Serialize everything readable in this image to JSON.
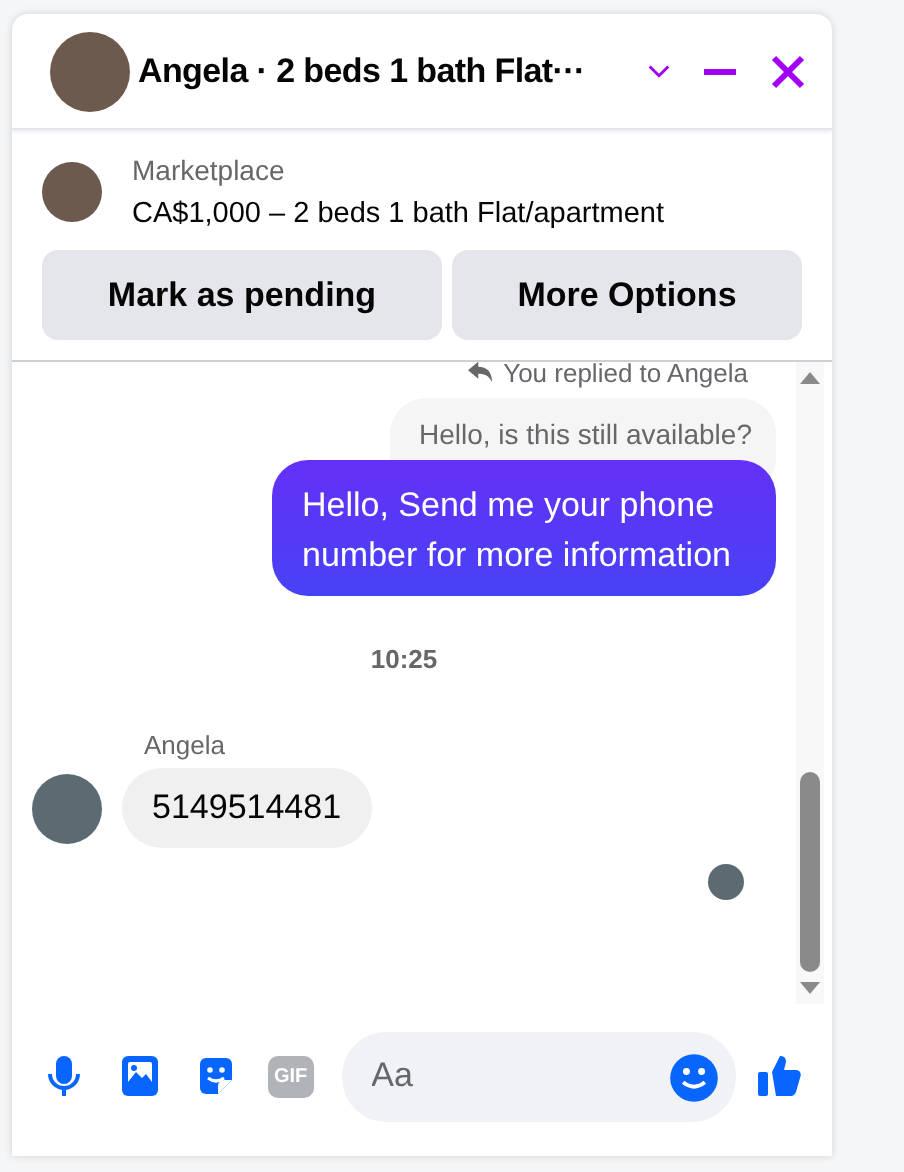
{
  "header": {
    "title": "Angela · 2 beds 1 bath Flat···"
  },
  "listing": {
    "source": "Marketplace",
    "summary": "CA$1,000 – 2 beds 1 bath Flat/apartment"
  },
  "actions": [
    "Mark as pending",
    "More Options"
  ],
  "messages": [
    {
      "kind": "reply-note",
      "text": "You replied to Angela"
    },
    {
      "kind": "quoted",
      "text": "Hello, is this still available?"
    },
    {
      "kind": "outgoing",
      "text": "Hello, Send me your phone number for more information"
    },
    {
      "kind": "timestamp",
      "text": "10:25"
    },
    {
      "kind": "sender",
      "text": "Angela"
    },
    {
      "kind": "incoming",
      "text": "5149514481"
    },
    {
      "kind": "seen"
    }
  ],
  "composer": {
    "gif_label": "GIF",
    "placeholder": "Aa"
  }
}
